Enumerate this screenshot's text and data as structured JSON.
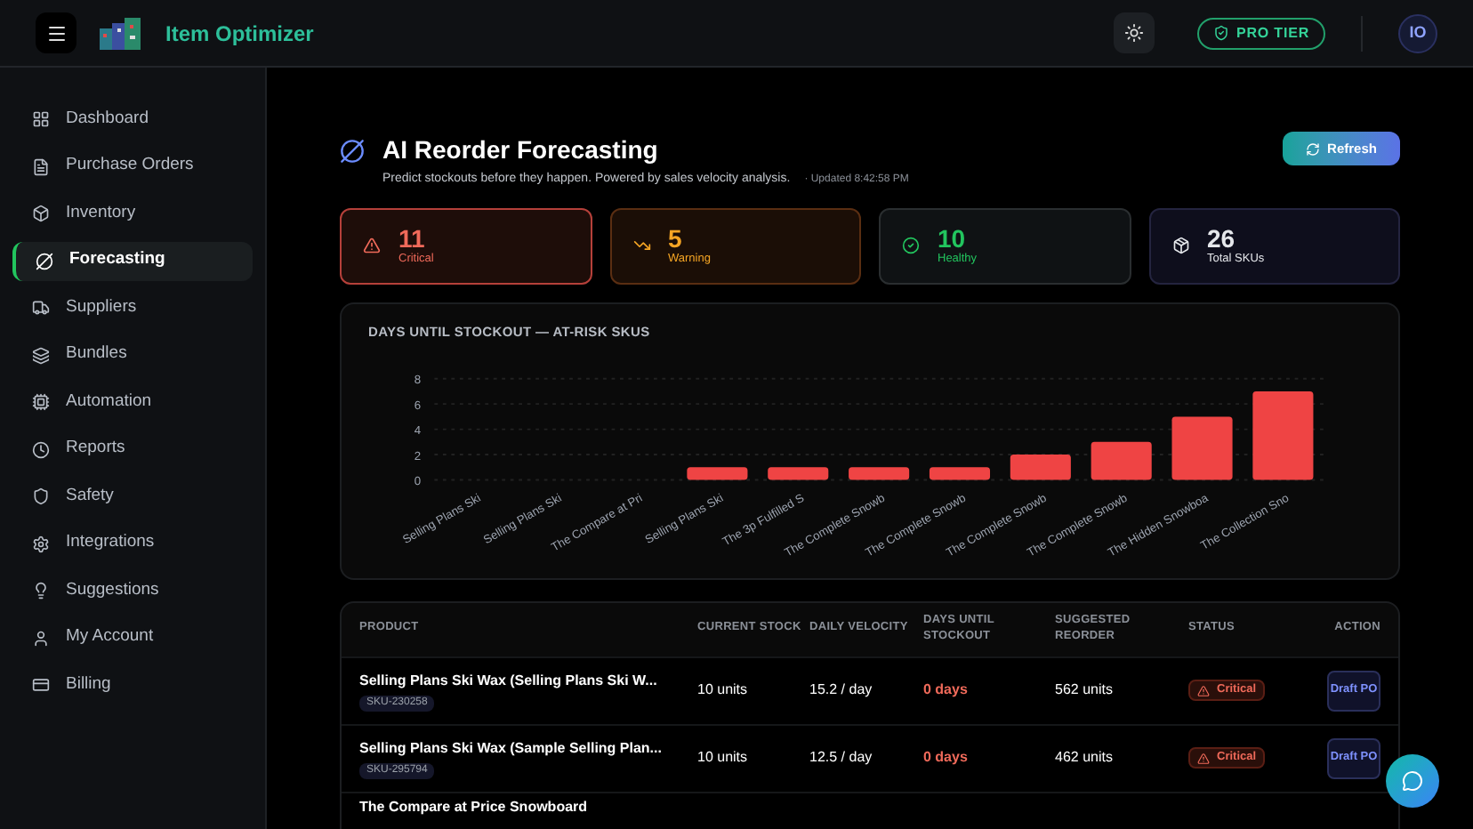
{
  "header": {
    "app_name": "Item Optimizer",
    "badge": "PRO TIER",
    "avatar": "IO"
  },
  "sidebar": {
    "items": [
      {
        "label": "Dashboard",
        "selected": false
      },
      {
        "label": "Purchase Orders",
        "selected": false
      },
      {
        "label": "Inventory",
        "selected": false
      },
      {
        "label": "Forecasting",
        "selected": true
      },
      {
        "label": "Suppliers",
        "selected": false
      },
      {
        "label": "Bundles",
        "selected": false
      },
      {
        "label": "Automation",
        "selected": false
      },
      {
        "label": "Reports",
        "selected": false
      },
      {
        "label": "Safety",
        "selected": false
      },
      {
        "label": "Integrations",
        "selected": false
      },
      {
        "label": "Suggestions",
        "selected": false
      },
      {
        "label": "My Account",
        "selected": false
      },
      {
        "label": "Billing",
        "selected": false
      }
    ]
  },
  "page": {
    "title": "AI Reorder Forecasting",
    "subtitle": "Predict stockouts before they happen. Powered by sales velocity analysis.",
    "updated": "· Updated 8:42:58 PM",
    "refresh_button": "Refresh"
  },
  "stats": [
    {
      "kind": "critical",
      "value": "11",
      "label": "Critical"
    },
    {
      "kind": "warning",
      "value": "5",
      "label": "Warning"
    },
    {
      "kind": "healthy",
      "value": "10",
      "label": "Healthy"
    },
    {
      "kind": "total",
      "value": "26",
      "label": "Total SKUs"
    }
  ],
  "chart": {
    "title": "DAYS UNTIL STOCKOUT — AT-RISK SKUS",
    "chart_data": {
      "type": "bar",
      "categories": [
        "Selling Plans Ski",
        "Selling Plans Ski",
        "The Compare at Pri",
        "Selling Plans Ski",
        "The 3p Fulfilled S",
        "The Complete Snowb",
        "The Complete Snowb",
        "The Complete Snowb",
        "The Complete Snowb",
        "The Hidden Snowboa",
        "The Collection Sno"
      ],
      "values": [
        0,
        0,
        0,
        1,
        1,
        1,
        1,
        2,
        3,
        5,
        7
      ],
      "ylim": [
        0,
        8
      ],
      "yticks": [
        0,
        2,
        4,
        6,
        8
      ],
      "grid": true
    }
  },
  "table": {
    "columns": [
      "PRODUCT",
      "CURRENT STOCK",
      "DAILY VELOCITY",
      "DAYS UNTIL STOCKOUT",
      "SUGGESTED REORDER",
      "STATUS",
      "ACTION"
    ],
    "rows": [
      {
        "kind": "critical",
        "product": "Selling Plans Ski Wax (Selling Plans Ski W...",
        "sku": "SKU-230258",
        "stock": "10 units",
        "velocity": "15.2 / day",
        "days": "0 days",
        "reorder": "562 units",
        "status": "Critical",
        "action": "Draft PO"
      },
      {
        "kind": "critical",
        "product": "Selling Plans Ski Wax (Sample Selling Plan...",
        "sku": "SKU-295794",
        "stock": "10 units",
        "velocity": "12.5 / day",
        "days": "0 days",
        "reorder": "462 units",
        "status": "Critical",
        "action": "Draft PO"
      },
      {
        "kind": "partial",
        "product": "The Compare at Price Snowboard"
      }
    ]
  }
}
